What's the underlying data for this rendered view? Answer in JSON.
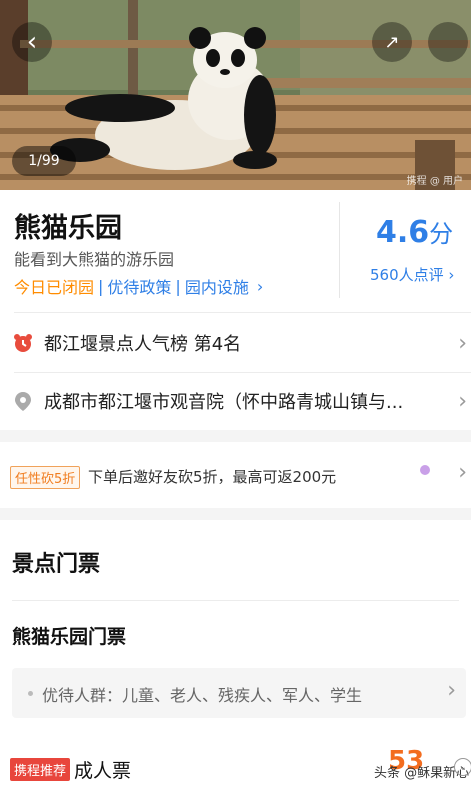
{
  "hero": {
    "image_counter": "1/99",
    "watermark": "携程 @ 用户"
  },
  "attraction": {
    "name": "熊猫乐园",
    "subtitle": "能看到大熊猫的游乐园",
    "status": "今日已闭园",
    "link1": "优待政策",
    "link2": "园内设施",
    "score": "4.6",
    "score_unit": "分",
    "reviews": "560人点评"
  },
  "ranking": {
    "text": "都江堰景点人气榜 第4名"
  },
  "address": {
    "text": "成都市都江堰市观音院（怀中路青城山镇与..."
  },
  "promo": {
    "badge": "任性砍5折",
    "text": "下单后邀好友砍5折，最高可返200元"
  },
  "tickets": {
    "section_title": "景点门票",
    "group_title": "熊猫乐园门票",
    "discount_text": "优待人群：儿童、老人、残疾人、军人、学生",
    "recommend_badge": "携程推荐",
    "ticket_name": "成人票",
    "price": "53"
  },
  "footer_watermark": "头条 @稣果新心",
  "colors": {
    "accent_blue": "#2f7fe6",
    "orange": "#f36d1f",
    "red": "#e8463c"
  },
  "icons": [
    "back-arrow-icon",
    "share-icon",
    "alarm-clock-icon",
    "location-pin-icon",
    "chevron-right-icon"
  ]
}
